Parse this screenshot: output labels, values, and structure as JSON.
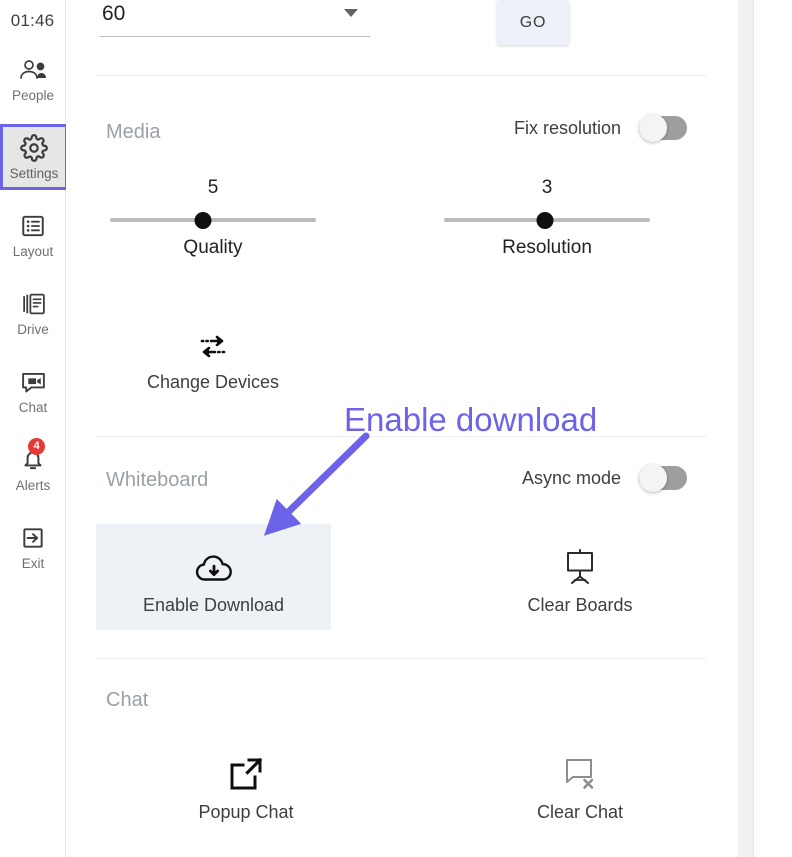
{
  "sidebar": {
    "clock": "01:46",
    "items": [
      {
        "label": "People",
        "icon": "people-icon",
        "selected": false,
        "badge": null
      },
      {
        "label": "Settings",
        "icon": "gear-icon",
        "selected": true,
        "badge": null
      },
      {
        "label": "Layout",
        "icon": "layout-icon",
        "selected": false,
        "badge": null
      },
      {
        "label": "Drive",
        "icon": "drive-icon",
        "selected": false,
        "badge": null
      },
      {
        "label": "Chat",
        "icon": "chat-icon",
        "selected": false,
        "badge": null
      },
      {
        "label": "Alerts",
        "icon": "bell-icon",
        "selected": false,
        "badge": "4"
      },
      {
        "label": "Exit",
        "icon": "exit-icon",
        "selected": false,
        "badge": null
      }
    ]
  },
  "top": {
    "select_value": "60",
    "select_icon": "chevron-down-icon",
    "go_label": "GO"
  },
  "media": {
    "title": "Media",
    "fix_resolution": {
      "label": "Fix resolution",
      "state": "off"
    },
    "sliders": [
      {
        "label": "Quality",
        "value": "5",
        "percent": 45
      },
      {
        "label": "Resolution",
        "value": "3",
        "percent": 49
      }
    ],
    "change_devices": {
      "label": "Change Devices",
      "icon": "swap-arrows-icon"
    }
  },
  "whiteboard": {
    "title": "Whiteboard",
    "async_mode": {
      "label": "Async mode",
      "state": "off"
    },
    "tiles": [
      {
        "label": "Enable Download",
        "icon": "cloud-download-icon",
        "highlighted": true
      },
      {
        "label": "Clear Boards",
        "icon": "easel-icon",
        "highlighted": false
      }
    ]
  },
  "chat": {
    "title": "Chat",
    "tiles": [
      {
        "label": "Popup Chat",
        "icon": "open-in-new-icon",
        "highlighted": false
      },
      {
        "label": "Clear Chat",
        "icon": "chat-remove-icon",
        "highlighted": false
      }
    ]
  },
  "annotation": {
    "text": "Enable download",
    "color": "#6c63e8"
  },
  "colors": {
    "accent": "#6c63e8",
    "badge": "#e53935",
    "highlight_tile": "#eef2f7",
    "go_button": "#eef1f7",
    "muted_text": "#9aa0a6",
    "body_text": "#3c4043"
  }
}
